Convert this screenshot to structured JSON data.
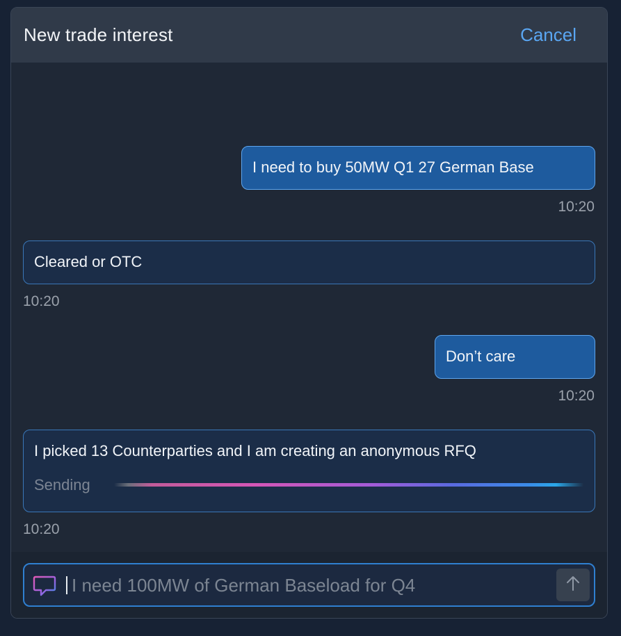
{
  "header": {
    "title": "New trade interest",
    "cancel_label": "Cancel"
  },
  "messages": [
    {
      "sender": "user",
      "text": "I need to buy 50MW Q1 27 German Base",
      "time": "10:20"
    },
    {
      "sender": "bot",
      "text": "Cleared or OTC",
      "time": "10:20"
    },
    {
      "sender": "user",
      "text": "Don’t care",
      "time": "10:20"
    },
    {
      "sender": "bot",
      "text": "I picked 13 Counterparties and I am creating an anonymous RFQ",
      "status": "Sending",
      "time": "10:20"
    }
  ],
  "composer": {
    "placeholder": "I need 100MW of German Baseload for Q4",
    "value": "",
    "chat_icon": "chat-bubble-icon",
    "send_icon": "arrow-up-icon"
  },
  "colors": {
    "accent": "#5aa6f2",
    "user_bubble": "#1e5b9e",
    "bot_bubble": "#1b2d48"
  }
}
